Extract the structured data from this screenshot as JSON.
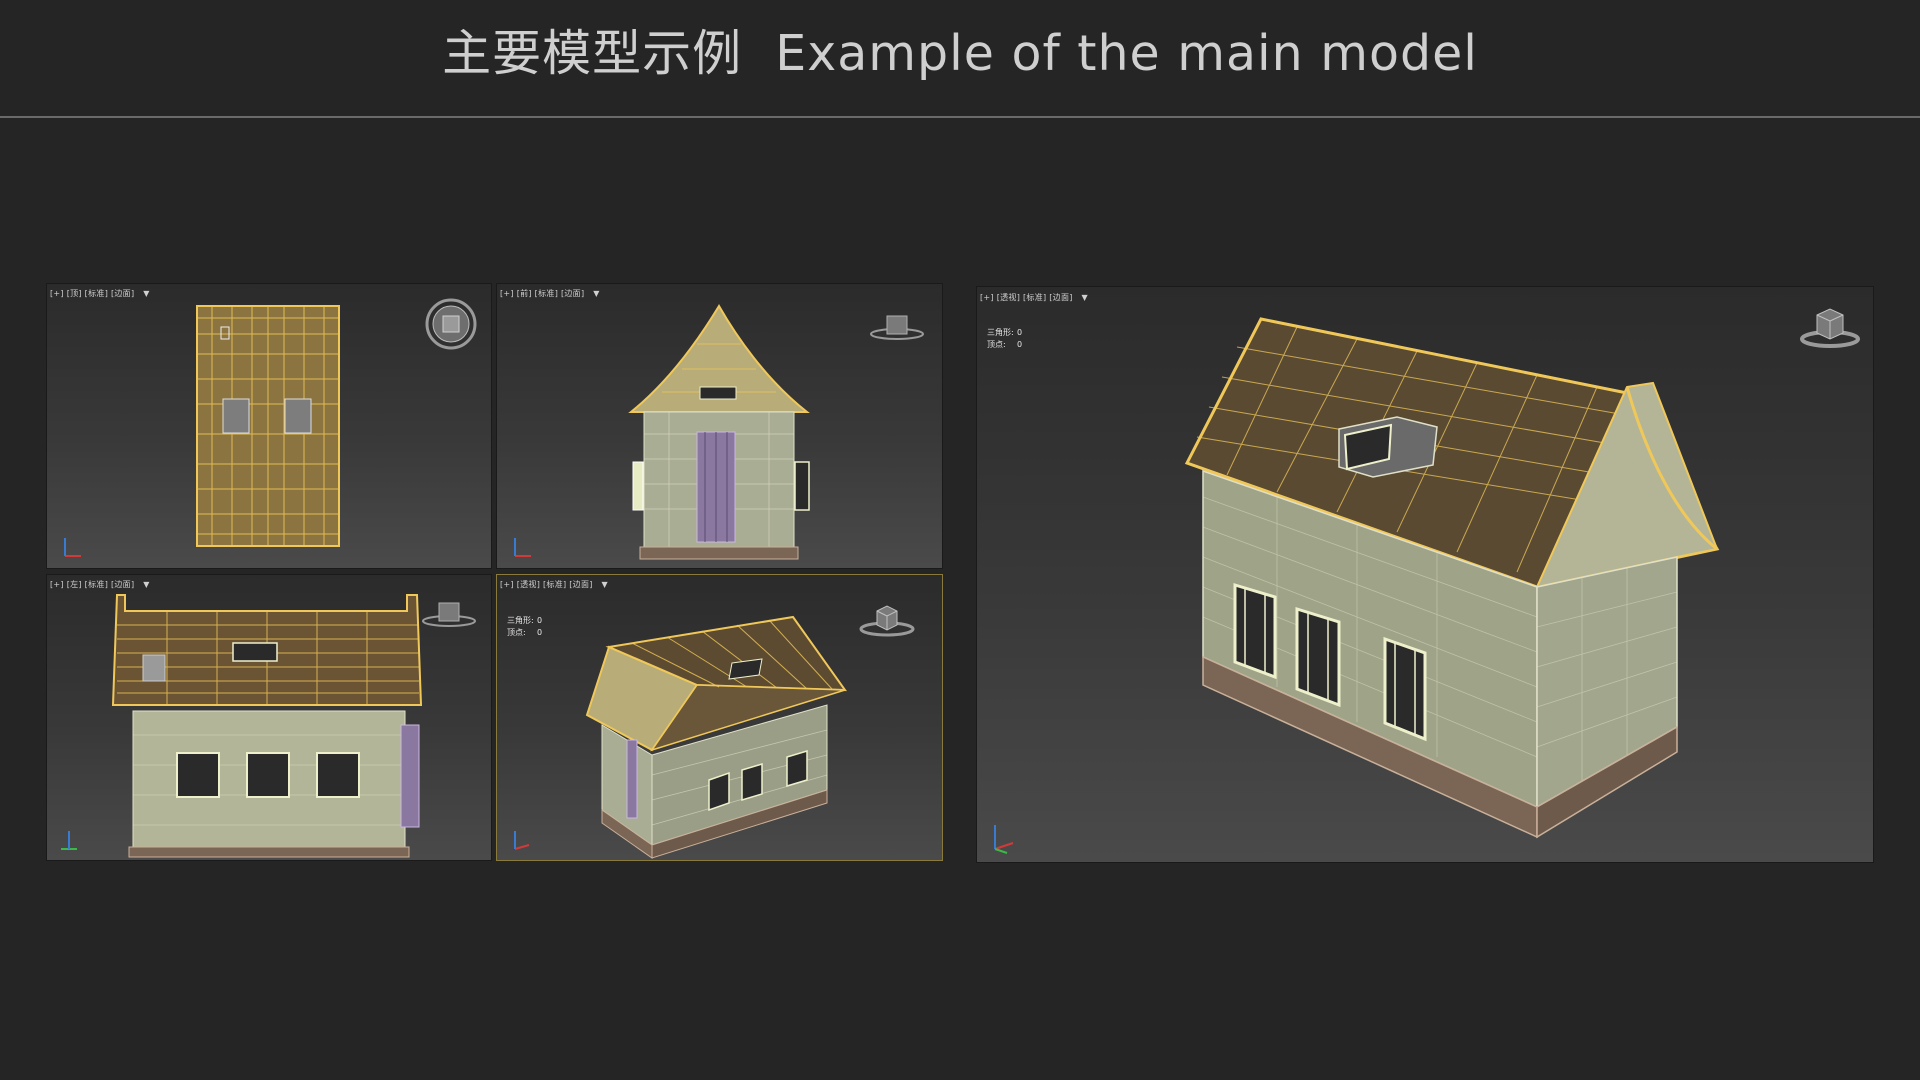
{
  "page": {
    "title": "主要模型示例  Example of the main model"
  },
  "viewports": {
    "top": {
      "label": "[+] [顶] [标准] [边面]",
      "filter_icon": "filter-icon",
      "navcube_icon": "navcube-top-icon"
    },
    "front": {
      "label": "[+] [前] [标准] [边面]",
      "filter_icon": "filter-icon",
      "navcube_icon": "navcube-front-icon"
    },
    "left": {
      "label": "[+] [左] [标准] [边面]",
      "filter_icon": "filter-icon",
      "navcube_icon": "navcube-left-icon"
    },
    "persp_small": {
      "label": "[+] [透视] [标准] [边面]",
      "filter_icon": "filter-icon",
      "navcube_icon": "navcube-perspective-icon",
      "stats": {
        "tris_label": "三角形:",
        "tris_value": "0",
        "verts_label": "顶点:",
        "verts_value": "0"
      }
    },
    "persp_large": {
      "label": "[+] [透视] [标准] [边面]",
      "filter_icon": "filter-icon",
      "navcube_icon": "navcube-perspective-icon",
      "stats": {
        "tris_label": "三角形:",
        "tris_value": "0",
        "verts_label": "顶点:",
        "verts_value": "0"
      }
    }
  },
  "colors": {
    "background": "#252525",
    "wireframe": "#e7c15a",
    "wall": "#a6a98e",
    "roof": "#5a4a32",
    "foundation": "#7b6656",
    "door": "#8a78a0",
    "window_frame": "#eef0cc"
  }
}
